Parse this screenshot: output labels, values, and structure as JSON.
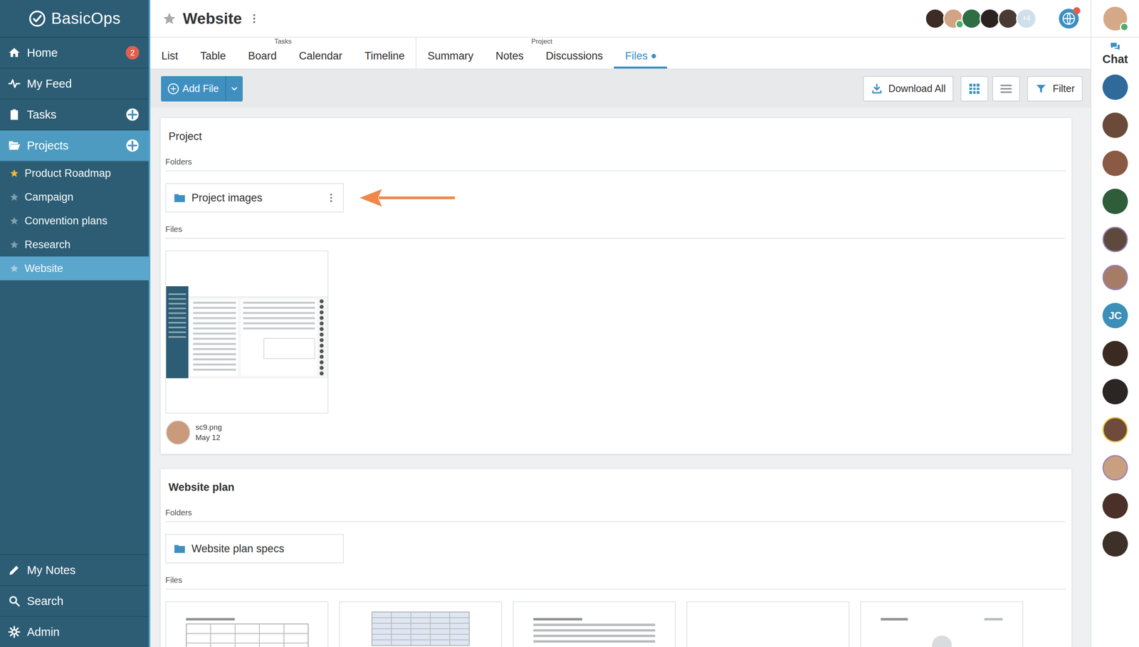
{
  "app": {
    "name": "BasicOps"
  },
  "sidebar": {
    "items": [
      {
        "label": "Home",
        "badge": "2",
        "add": false,
        "selected": false
      },
      {
        "label": "My Feed",
        "badge": "",
        "add": false,
        "selected": false
      },
      {
        "label": "Tasks",
        "badge": "",
        "add": true,
        "selected": false
      },
      {
        "label": "Projects",
        "badge": "",
        "add": true,
        "selected": true
      }
    ],
    "projects": [
      {
        "label": "Product Roadmap",
        "starred": true,
        "selected": false
      },
      {
        "label": "Campaign",
        "starred": false,
        "selected": false
      },
      {
        "label": "Convention plans",
        "starred": false,
        "selected": false
      },
      {
        "label": "Research",
        "starred": false,
        "selected": false
      },
      {
        "label": "Website",
        "starred": false,
        "selected": true
      }
    ],
    "bottom": [
      {
        "label": "My Notes"
      },
      {
        "label": "Search"
      },
      {
        "label": "Admin"
      }
    ]
  },
  "header": {
    "title": "Website",
    "starred": false,
    "members": [
      {
        "online": false
      },
      {
        "online": true
      },
      {
        "online": false
      },
      {
        "online": false
      },
      {
        "online": false
      }
    ],
    "more": "+4",
    "notification": true
  },
  "tab_groups": [
    {
      "label": "Tasks",
      "tabs": [
        {
          "label": "List",
          "selected": false,
          "unread": false
        },
        {
          "label": "Table",
          "selected": false,
          "unread": false
        },
        {
          "label": "Board",
          "selected": false,
          "unread": false
        },
        {
          "label": "Calendar",
          "selected": false,
          "unread": false
        },
        {
          "label": "Timeline",
          "selected": false,
          "unread": false
        }
      ]
    },
    {
      "label": "Project",
      "tabs": [
        {
          "label": "Summary",
          "selected": false,
          "unread": false
        },
        {
          "label": "Notes",
          "selected": false,
          "unread": false
        },
        {
          "label": "Discussions",
          "selected": false,
          "unread": false
        },
        {
          "label": "Files",
          "selected": true,
          "unread": true
        }
      ]
    }
  ],
  "toolbar": {
    "add": "Add File",
    "download": "Download All",
    "views": [
      {
        "kind": "grid",
        "selected": true
      },
      {
        "kind": "list",
        "selected": false
      }
    ],
    "filter": "Filter"
  },
  "sections": [
    {
      "title": "Project",
      "bold": false,
      "folders_label": "Folders",
      "folders": [
        {
          "name": "Project images",
          "menu": true,
          "highlighted": true
        }
      ],
      "files_label": "Files",
      "files": [
        {
          "kind": "screenshot",
          "name": "sc9.png",
          "date": "May 12"
        }
      ]
    },
    {
      "title": "Website plan",
      "bold": true,
      "folders_label": "Folders",
      "folders": [
        {
          "name": "Website plan specs",
          "menu": false,
          "highlighted": false
        }
      ],
      "files_label": "Files",
      "files": [
        {
          "kind": "canvas",
          "name": "",
          "date": ""
        },
        {
          "kind": "sheet",
          "name": "",
          "date": ""
        },
        {
          "kind": "doc",
          "name": "",
          "date": ""
        },
        {
          "kind": "blank",
          "name": "",
          "date": ""
        },
        {
          "kind": "site",
          "name": "",
          "date": ""
        }
      ]
    }
  ],
  "chat": {
    "label": "Chat",
    "me": {
      "online": true
    },
    "people": [
      {
        "initials": ""
      },
      {
        "initials": ""
      },
      {
        "initials": ""
      },
      {
        "initials": ""
      },
      {
        "initials": ""
      },
      {
        "initials": ""
      },
      {
        "initials": "JC"
      },
      {
        "initials": ""
      },
      {
        "initials": ""
      },
      {
        "initials": ""
      },
      {
        "initials": ""
      },
      {
        "initials": ""
      },
      {
        "initials": ""
      }
    ]
  }
}
